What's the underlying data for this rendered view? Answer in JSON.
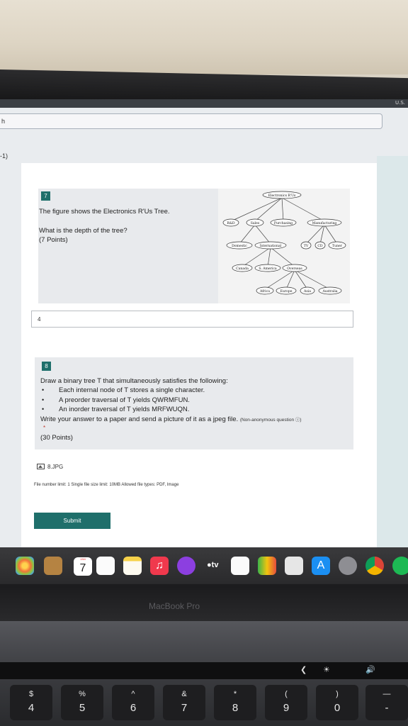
{
  "menubar": {
    "language": "U.S."
  },
  "browser": {
    "url_fragment": "h"
  },
  "previous_label": "-1)",
  "question7": {
    "number": "7",
    "prompt": "The figure shows the Electronics R'Us Tree.",
    "question": "What is the depth of the tree?",
    "points": "(7 Points)",
    "tree": {
      "root": "Electronics R'Us",
      "level1": [
        "R&D",
        "Sales",
        "Purchasing",
        "Manufacturing"
      ],
      "level2": [
        "Domestic",
        "International",
        "TV",
        "CD",
        "Tuner"
      ],
      "level3": [
        "Canada",
        "S. America",
        "Overseas"
      ],
      "level4": [
        "Africa",
        "Europe",
        "Asia",
        "Australia"
      ]
    },
    "answer": "4"
  },
  "question8": {
    "number": "8",
    "lead": "Draw a binary tree T that simultaneously satisfies the following:",
    "items": [
      "Each internal node of T stores a single character.",
      "A preorder traversal of T yields QWRMFUN.",
      "An inorder traversal of T yields MRFWUQN."
    ],
    "instruction": "Write your answer to a paper and send a picture of it as a jpeg file.",
    "anonymous_note": "(Non-anonymous question",
    "required_mark": "*",
    "points": "(30 Points)"
  },
  "upload": {
    "file_name": "8.JPG",
    "limits": "File number limit: 1   Single file size limit: 10MB   Allowed file types: PDF, Image"
  },
  "submit_label": "Submit",
  "dock": {
    "calendar_month": "JAN",
    "calendar_day": "7",
    "tv_label": "tv",
    "icons": [
      "photos-icon",
      "contacts-icon",
      "calendar-icon",
      "reminders-icon",
      "notes-icon",
      "music-icon",
      "podcasts-icon",
      "apple-tv-icon",
      "icloud-drive-icon",
      "numbers-icon",
      "preview-icon",
      "app-store-icon",
      "system-preferences-icon",
      "chrome-icon",
      "spotify-icon"
    ]
  },
  "brand": "MacBook Pro",
  "keyboard": {
    "keys": [
      {
        "top": "$",
        "bottom": "4"
      },
      {
        "top": "%",
        "bottom": "5"
      },
      {
        "top": "^",
        "bottom": "6"
      },
      {
        "top": "&",
        "bottom": "7"
      },
      {
        "top": "*",
        "bottom": "8"
      },
      {
        "top": "(",
        "bottom": "9"
      },
      {
        "top": ")",
        "bottom": "0"
      },
      {
        "top": "—",
        "bottom": "-"
      }
    ]
  }
}
